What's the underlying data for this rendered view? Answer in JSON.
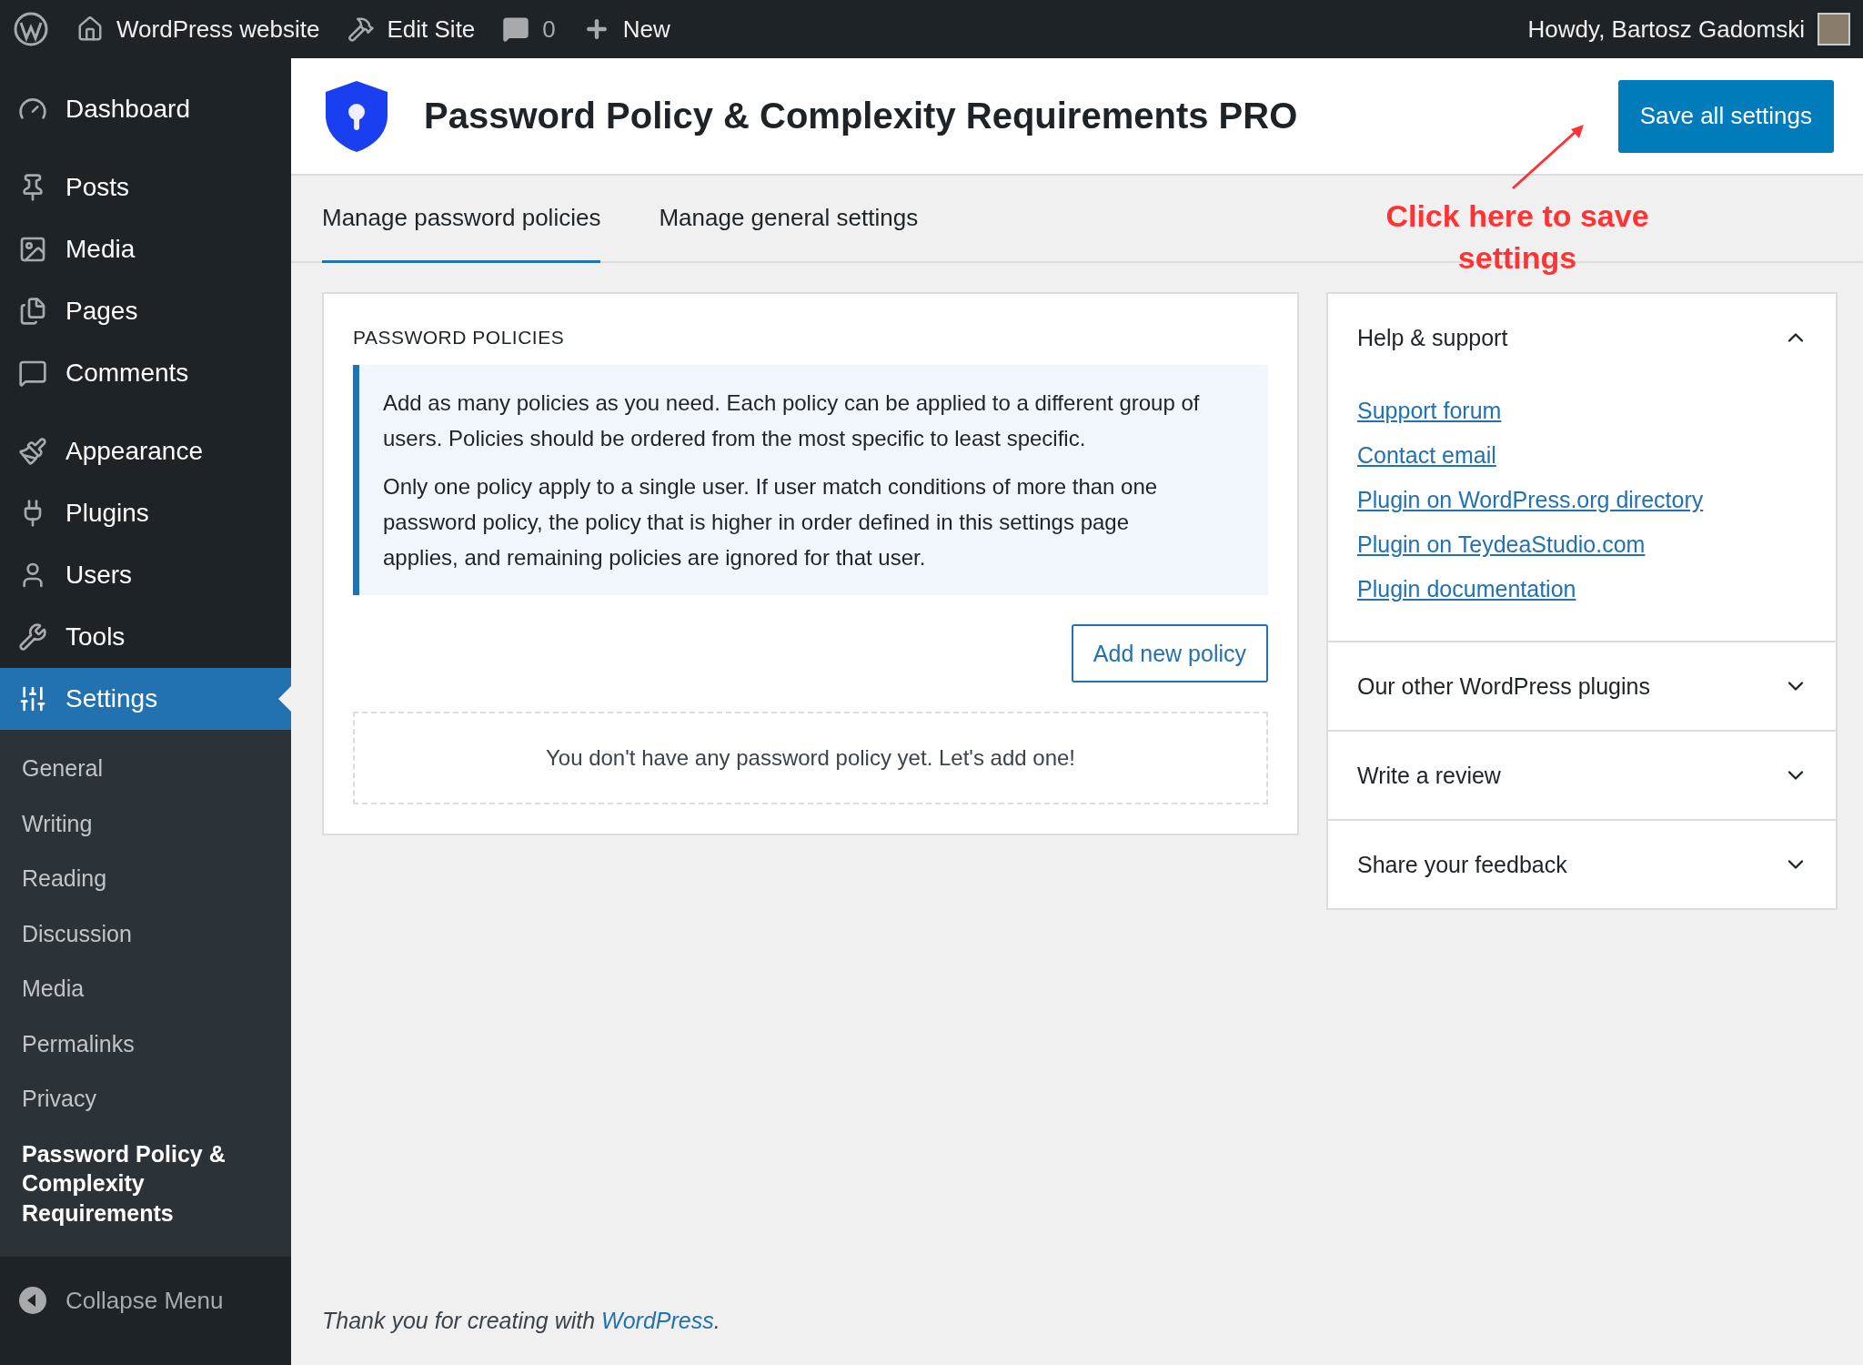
{
  "admin_bar": {
    "site_name": "WordPress website",
    "edit_site": "Edit Site",
    "comments_count": "0",
    "new": "New",
    "greeting": "Howdy, Bartosz Gadomski"
  },
  "sidebar": {
    "groups": [
      [
        {
          "label": "Dashboard",
          "selected": false
        }
      ],
      [
        {
          "label": "Posts",
          "selected": false
        },
        {
          "label": "Media",
          "selected": false
        },
        {
          "label": "Pages",
          "selected": false
        },
        {
          "label": "Comments",
          "selected": false
        }
      ],
      [
        {
          "label": "Appearance",
          "selected": false
        },
        {
          "label": "Plugins",
          "selected": false
        },
        {
          "label": "Users",
          "selected": false
        },
        {
          "label": "Tools",
          "selected": false
        },
        {
          "label": "Settings",
          "selected": true,
          "children": [
            {
              "label": "General",
              "selected": false
            },
            {
              "label": "Writing",
              "selected": false
            },
            {
              "label": "Reading",
              "selected": false
            },
            {
              "label": "Discussion",
              "selected": false
            },
            {
              "label": "Media",
              "selected": false
            },
            {
              "label": "Permalinks",
              "selected": false
            },
            {
              "label": "Privacy",
              "selected": false
            },
            {
              "label": "Password Policy & Complexity Requirements",
              "selected": true
            }
          ]
        }
      ]
    ],
    "collapse": "Collapse Menu"
  },
  "header": {
    "title": "Password Policy & Complexity Requirements PRO",
    "save_button": "Save all settings"
  },
  "tabs": [
    {
      "label": "Manage password policies",
      "selected": true
    },
    {
      "label": "Manage general settings",
      "selected": false
    }
  ],
  "annotation": "Click here to save settings",
  "policies": {
    "heading": "PASSWORD POLICIES",
    "notice": [
      "Add as many policies as you need. Each policy can be applied to a different group of users. Policies should be ordered from the most specific to least specific.",
      "Only one policy apply to a single user. If user match conditions of more than one password policy, the policy that is higher in order defined in this settings page applies, and remaining policies are ignored for that user."
    ],
    "add_button": "Add new policy",
    "empty": "You don't have any password policy yet. Let's add one!"
  },
  "side_panels": [
    {
      "title": "Help & support",
      "expanded": true,
      "links": [
        "Support forum",
        "Contact email",
        "Plugin on WordPress.org directory",
        "Plugin on TeydeaStudio.com",
        "Plugin documentation"
      ]
    },
    {
      "title": "Our other WordPress plugins",
      "expanded": false
    },
    {
      "title": "Write a review",
      "expanded": false
    },
    {
      "title": "Share your feedback",
      "expanded": false
    }
  ],
  "footer": {
    "text": "Thank you for creating with ",
    "link": "WordPress",
    "end": "."
  }
}
